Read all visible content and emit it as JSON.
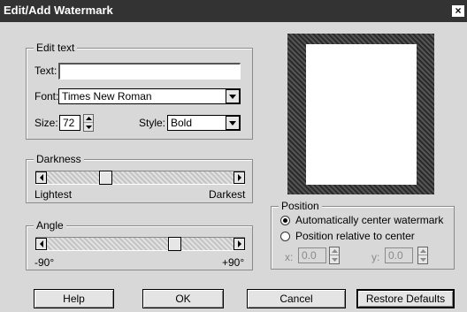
{
  "window": {
    "title": "Edit/Add Watermark",
    "close_glyph": "×"
  },
  "edit_text": {
    "group_label": "Edit text",
    "text_label": "Text:",
    "text_value": "",
    "font_label": "Font:",
    "font_value": "Times New Roman",
    "size_label": "Size:",
    "size_value": "72",
    "style_label": "Style:",
    "style_value": "Bold"
  },
  "darkness": {
    "group_label": "Darkness",
    "min_label": "Lightest",
    "max_label": "Darkest",
    "level": 0.3
  },
  "angle": {
    "group_label": "Angle",
    "min_label": "-90°",
    "max_label": "+90°",
    "level": 0.7
  },
  "position": {
    "group_label": "Position",
    "option_auto": "Automatically center watermark",
    "option_relative": "Position relative to center",
    "selected": "auto",
    "x_label": "x:",
    "x_value": "0.0",
    "y_label": "y:",
    "y_value": "0.0"
  },
  "buttons": {
    "help": "Help",
    "ok": "OK",
    "cancel": "Cancel",
    "restore": "Restore Defaults"
  }
}
